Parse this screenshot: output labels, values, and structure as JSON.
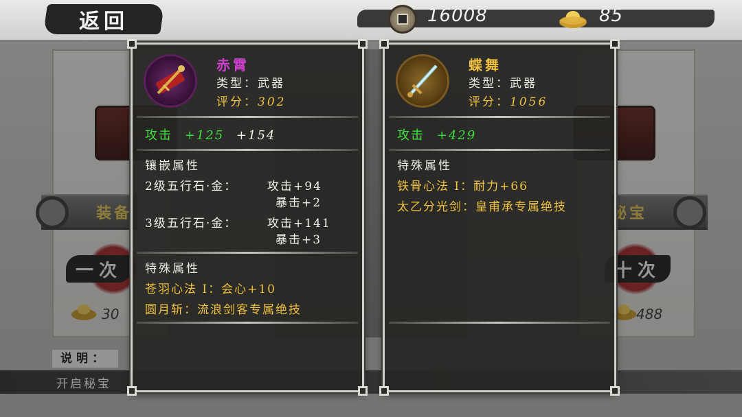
{
  "header": {
    "back_label": "返回",
    "coins": "16008",
    "ingots": "85"
  },
  "background": {
    "left_ribbon_label": "装备",
    "right_ribbon_label": "秘宝",
    "left_button_label": "一次",
    "right_button_label": "十次",
    "left_price": "30",
    "right_price": "488",
    "description_label": "说明：",
    "description_text": "开启秘宝"
  },
  "left_item": {
    "name": "赤霄",
    "name_color": "#d040d0",
    "type_label": "类型：",
    "type_value": "武器",
    "score_label": "评分：",
    "score_value": "302",
    "attack_label": "攻击",
    "attack_value": "+125",
    "attack_extra": "+154",
    "inlay_title": "镶嵌属性",
    "inlays": [
      {
        "name": "2级五行石·金：",
        "stat1": "攻击+94",
        "stat2": "暴击+2"
      },
      {
        "name": "3级五行石·金：",
        "stat1": "攻击+141",
        "stat2": "暴击+3"
      }
    ],
    "special_title": "特殊属性",
    "specials": [
      "苍羽心法 I：会心+10",
      "圆月斩：流浪剑客专属绝技"
    ]
  },
  "right_item": {
    "name": "蝶舞",
    "name_color": "#f0c040",
    "type_label": "类型：",
    "type_value": "武器",
    "score_label": "评分：",
    "score_value": "1056",
    "attack_label": "攻击",
    "attack_value": "+429",
    "special_title": "特殊属性",
    "specials": [
      "铁骨心法 I：耐力+66",
      "太乙分光剑：皇甫承专属绝技"
    ]
  }
}
